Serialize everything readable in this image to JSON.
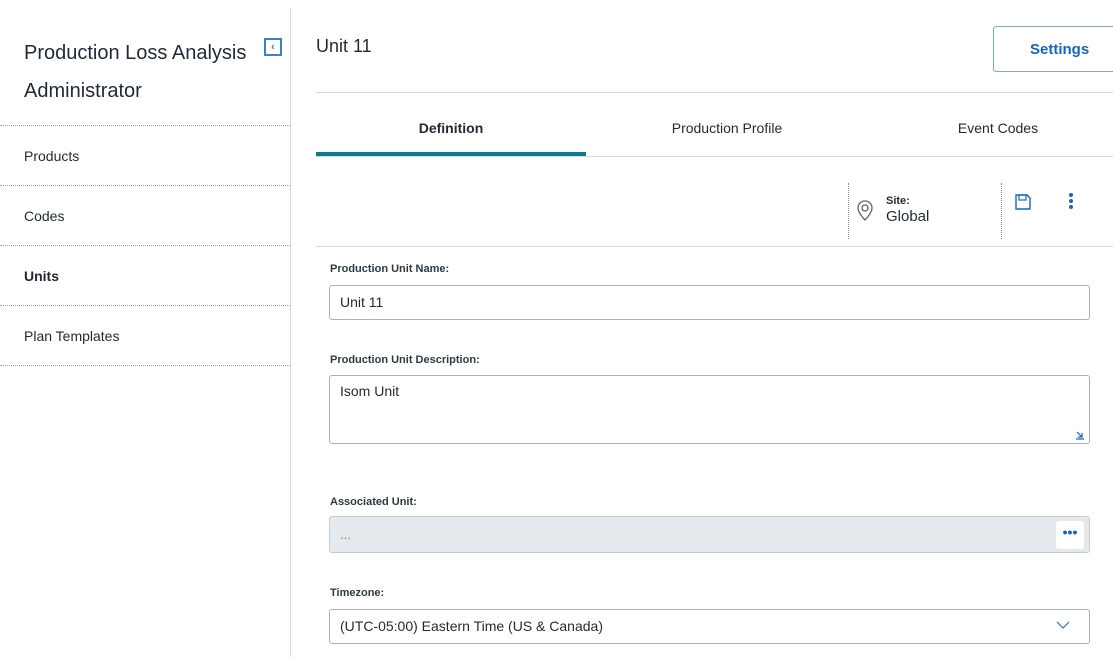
{
  "sidebar": {
    "title": "Production Loss Analysis Administrator",
    "collapse_icon": "chevron-left-icon",
    "items": [
      {
        "label": "Products"
      },
      {
        "label": "Codes"
      },
      {
        "label": "Units",
        "active": true
      },
      {
        "label": "Plan Templates"
      }
    ]
  },
  "header": {
    "title": "Unit 11",
    "settings_label": "Settings"
  },
  "tabs": [
    {
      "label": "Definition",
      "active": true
    },
    {
      "label": "Production Profile"
    },
    {
      "label": "Event Codes"
    }
  ],
  "toolbar": {
    "site_label": "Site:",
    "site_value": "Global",
    "icons": [
      "location-pin-icon",
      "save-icon",
      "more-vertical-icon"
    ]
  },
  "form": {
    "name_label": "Production Unit Name:",
    "name_value": "Unit 11",
    "description_label": "Production Unit Description:",
    "description_value": "Isom Unit",
    "associated_label": "Associated Unit:",
    "associated_value": "...",
    "timezone_label": "Timezone:",
    "timezone_value": "(UTC-05:00) Eastern Time (US & Canada)"
  },
  "colors": {
    "accent": "#1565c0",
    "tab_indicator": "#0f7a8a",
    "disabled_field": "#e4e9ee"
  }
}
